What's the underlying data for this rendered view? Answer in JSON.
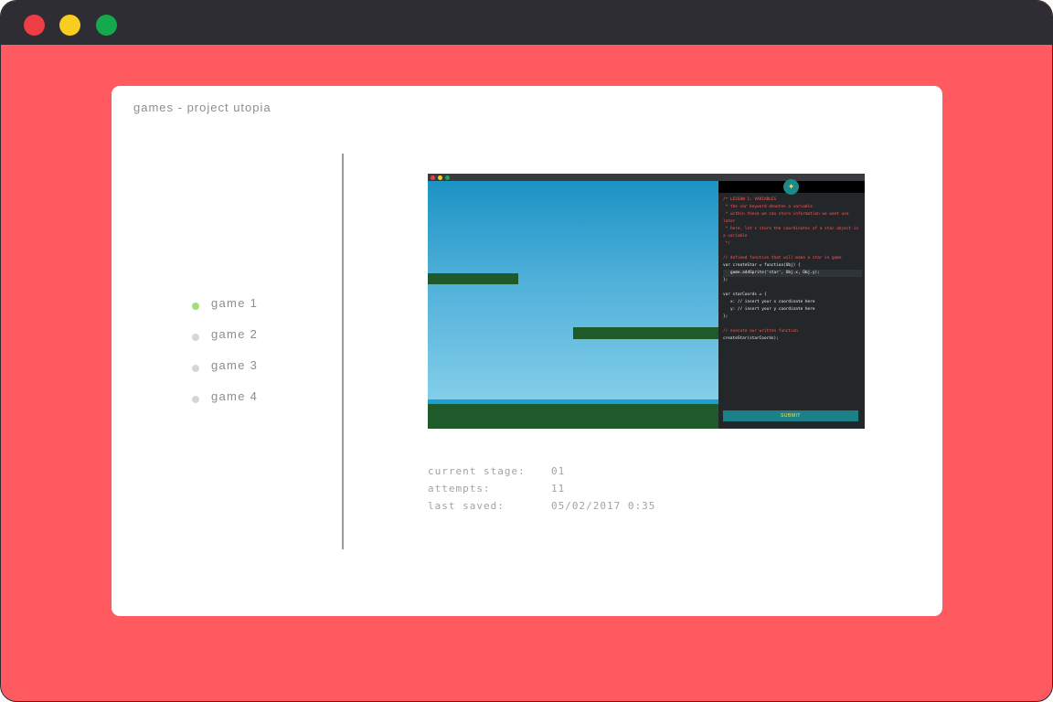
{
  "window": {
    "controls": [
      "close",
      "minimize",
      "maximize"
    ]
  },
  "card": {
    "title": "games - project utopia"
  },
  "nav": {
    "items": [
      {
        "label": "game 1",
        "active": true
      },
      {
        "label": "game 2",
        "active": false
      },
      {
        "label": "game 3",
        "active": false
      },
      {
        "label": "game 4",
        "active": false
      }
    ]
  },
  "preview": {
    "submit_label": "SUBMIT",
    "code_lines": [
      {
        "text": "/* LESSON 1: VARIABLES",
        "comment": true
      },
      {
        "text": " * the var keyword denotes a variable",
        "comment": true
      },
      {
        "text": " * within these we can store information we want use later",
        "comment": true
      },
      {
        "text": " * here, let's store the coordinates of a star object in a variable",
        "comment": true
      },
      {
        "text": " */",
        "comment": true
      },
      {
        "text": " ",
        "comment": false
      },
      {
        "text": "// defined function that will make a star in game",
        "comment": true
      },
      {
        "text": "var createStar = function(Obj) {",
        "comment": false
      },
      {
        "text": "   game.addSprite('star', Obj.x, Obj.y);",
        "comment": false,
        "highlight": true
      },
      {
        "text": "};",
        "comment": false
      },
      {
        "text": " ",
        "comment": false
      },
      {
        "text": "var starCoords = {",
        "comment": false
      },
      {
        "text": "   x: // insert your x coordinate here",
        "comment": false
      },
      {
        "text": "   y: // insert your y coordinate here",
        "comment": false
      },
      {
        "text": "};",
        "comment": false
      },
      {
        "text": " ",
        "comment": false
      },
      {
        "text": "// execute our written function",
        "comment": true
      },
      {
        "text": "createStar(starCoords);",
        "comment": false
      }
    ]
  },
  "stats": {
    "stage_label": "current stage:",
    "stage_value": "01",
    "attempts_label": "attempts:",
    "attempts_value": "11",
    "saved_label": "last saved:",
    "saved_value": "05/02/2017 0:35"
  },
  "colors": {
    "background": "#ff5a5f",
    "titlebar": "#2e2d33",
    "active_bullet": "#a4de7b",
    "submit": "#1a8189"
  }
}
